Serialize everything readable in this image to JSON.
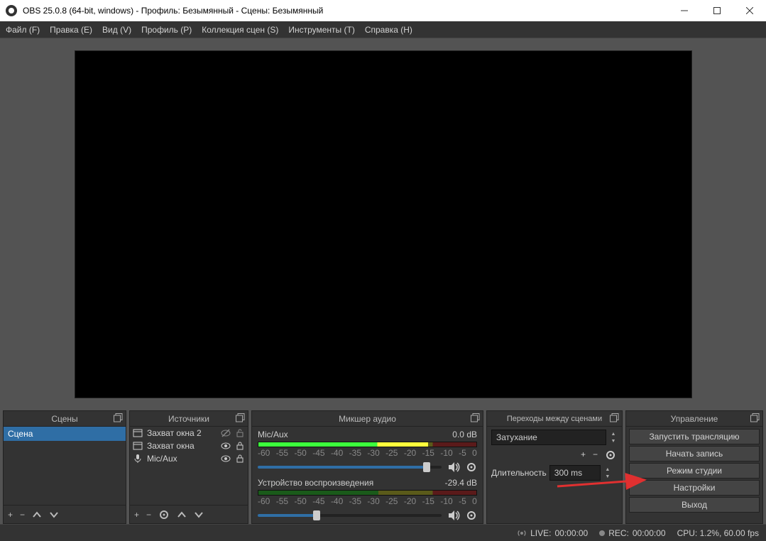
{
  "window": {
    "title": "OBS 25.0.8 (64-bit, windows) - Профиль: Безымянный - Сцены: Безымянный"
  },
  "menu": {
    "file": "Файл (F)",
    "edit": "Правка (E)",
    "view": "Вид (V)",
    "profile": "Профиль (P)",
    "scenes": "Коллекция сцен (S)",
    "tools": "Инструменты (T)",
    "help": "Справка (H)"
  },
  "docks": {
    "scenes": "Сцены",
    "sources": "Источники",
    "mixer": "Микшер аудио",
    "transitions": "Переходы между сценами",
    "controls": "Управление"
  },
  "scenes": {
    "items": [
      {
        "label": "Сцена"
      }
    ]
  },
  "sources": {
    "items": [
      {
        "label": "Захват окна 2",
        "visible": false,
        "locked": false,
        "icon": "window"
      },
      {
        "label": "Захват окна",
        "visible": true,
        "locked": true,
        "icon": "window"
      },
      {
        "label": "Mic/Aux",
        "visible": true,
        "locked": true,
        "icon": "mic"
      }
    ]
  },
  "mixer": {
    "channels": [
      {
        "name": "Mic/Aux",
        "db": "0.0 dB",
        "level": 78,
        "slider": 92
      },
      {
        "name": "Устройство воспроизведения",
        "db": "-29.4 dB",
        "level": 0,
        "slider": 32
      }
    ],
    "ticks": [
      "-60",
      "-55",
      "-50",
      "-45",
      "-40",
      "-35",
      "-30",
      "-25",
      "-20",
      "-15",
      "-10",
      "-5",
      "0"
    ]
  },
  "transitions": {
    "selected": "Затухание",
    "duration_label": "Длительность",
    "duration_value": "300 ms"
  },
  "controls": {
    "start_stream": "Запустить трансляцию",
    "start_record": "Начать запись",
    "studio": "Режим студии",
    "settings": "Настройки",
    "exit": "Выход"
  },
  "status": {
    "live_label": "LIVE:",
    "live_time": "00:00:00",
    "rec_label": "REC:",
    "rec_time": "00:00:00",
    "cpu": "CPU: 1.2%, 60.00 fps"
  }
}
